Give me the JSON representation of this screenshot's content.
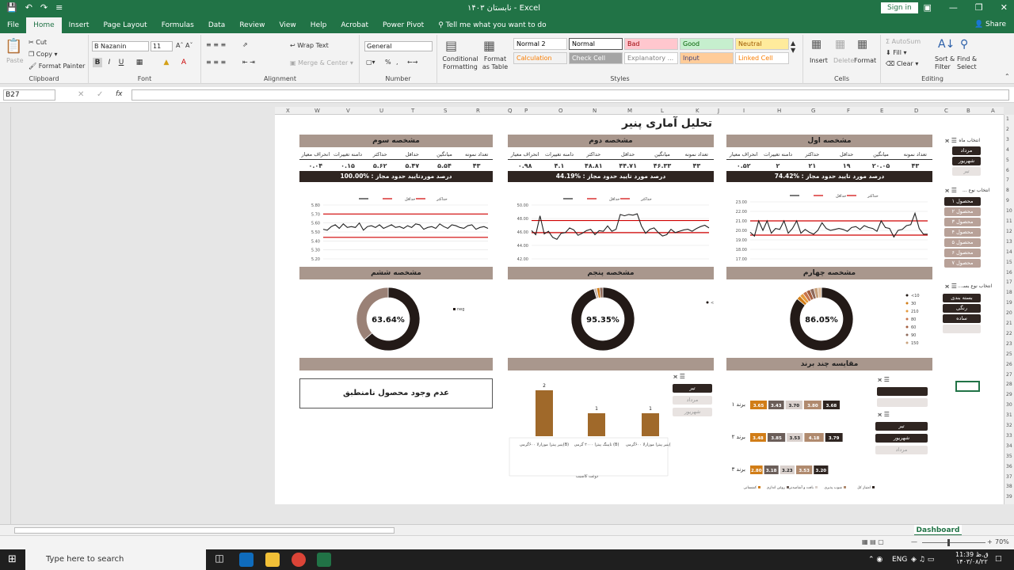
{
  "app": {
    "title": "نابستان ۱۴۰۳  -  Excel",
    "sign_in": "Sign in",
    "share": "Share"
  },
  "tabs": [
    "File",
    "Home",
    "Insert",
    "Page Layout",
    "Formulas",
    "Data",
    "Review",
    "View",
    "Help",
    "Acrobat",
    "Power Pivot",
    "Tell me what you want to do"
  ],
  "ribbon": {
    "clipboard": {
      "paste": "Paste",
      "cut": "Cut",
      "copy": "Copy",
      "format_painter": "Format Painter",
      "label": "Clipboard"
    },
    "font": {
      "name": "B Nazanin",
      "size": "11",
      "label": "Font",
      "bold": "B",
      "italic": "I",
      "underline": "U"
    },
    "alignment": {
      "wrap": "Wrap Text",
      "merge": "Merge & Center",
      "label": "Alignment"
    },
    "number": {
      "format": "General",
      "label": "Number",
      "pct": "%"
    },
    "styles": {
      "cond": "Conditional Formatting",
      "table": "Format as Table",
      "label": "Styles",
      "cells": [
        {
          "name": "Normal 2",
          "bg": "#ffffff",
          "fg": "#000000"
        },
        {
          "name": "Normal",
          "bg": "#ffffff",
          "fg": "#000000"
        },
        {
          "name": "Bad",
          "bg": "#ffc7ce",
          "fg": "#9c0006"
        },
        {
          "name": "Good",
          "bg": "#c6efce",
          "fg": "#006100"
        },
        {
          "name": "Neutral",
          "bg": "#ffeb9c",
          "fg": "#9c5700"
        },
        {
          "name": "Calculation",
          "bg": "#f2f2f2",
          "fg": "#fa7d00"
        },
        {
          "name": "Check Cell",
          "bg": "#a5a5a5",
          "fg": "#ffffff"
        },
        {
          "name": "Explanatory ...",
          "bg": "#ffffff",
          "fg": "#7f7f7f"
        },
        {
          "name": "Input",
          "bg": "#ffcc99",
          "fg": "#3f3f76"
        },
        {
          "name": "Linked Cell",
          "bg": "#ffffff",
          "fg": "#fa7d00"
        }
      ]
    },
    "cells": {
      "insert": "Insert",
      "delete": "Delete",
      "format": "Format",
      "label": "Cells"
    },
    "editing": {
      "autosum": "AutoSum",
      "fill": "Fill",
      "clear": "Clear",
      "sort": "Sort & Filter",
      "find": "Find & Select",
      "label": "Editing"
    }
  },
  "formula_bar": {
    "name_box": "B27",
    "formula": ""
  },
  "columns": [
    "X",
    "W",
    "V",
    "U",
    "T",
    "S",
    "R",
    "Q",
    "P",
    "O",
    "N",
    "M",
    "L",
    "K",
    "J",
    "I",
    "H",
    "G",
    "F",
    "E",
    "D",
    "C",
    "B",
    "A"
  ],
  "rows": [
    "1",
    "2",
    "3",
    "4",
    "5",
    "6",
    "7",
    "8",
    "9",
    "10",
    "11",
    "12",
    "13",
    "14",
    "15",
    "16",
    "17",
    "18",
    "19",
    "20",
    "21",
    "22",
    "23",
    "25",
    "26",
    "27",
    "28",
    "29",
    "30",
    "31",
    "32",
    "33",
    "34",
    "35",
    "36",
    "37",
    "38",
    "39"
  ],
  "dashboard": {
    "title": "تحلیل آماری پنیر",
    "kpi_headers": [
      "تعداد نمونه",
      "میانگین",
      "حداقل",
      "حداکثر",
      "دامنه تغییرات",
      "انحراف معیار"
    ],
    "sections": [
      {
        "title": "مشخصه اول",
        "values": [
          "۴۳",
          "۲۰.۰۵",
          "۱۹",
          "۲۱",
          "۲",
          "۰.۵۲"
        ],
        "conf": "74.42% : درصد مورد تایید حدود مجاز"
      },
      {
        "title": "مشخصه دوم",
        "values": [
          "۴۳",
          "۴۶.۳۳",
          "۴۴.۷۱",
          "۴۸.۸۱",
          "۴.۱",
          "۰.۹۸"
        ],
        "conf": "44.19% : درصد مورد تایید حدود مجاز"
      },
      {
        "title": "مشخصه سوم",
        "values": [
          "۴۳",
          "۵.۵۴",
          "۵.۴۷",
          "۵.۶۲",
          "۰.۱۵",
          "۰.۰۴"
        ],
        "conf": "100.00% : درصد موردتایید حدود مجاز"
      }
    ],
    "donut_headers": [
      "مشخصه چهارم",
      "مشخصه پنجم",
      "مشخصه ششم"
    ],
    "donut_values": [
      "86.05%",
      "95.35%",
      "63.64%"
    ],
    "compare_title": "مقایسه چند برند",
    "no_product": "عدم وجود محصول نامنطبق",
    "slicers": {
      "month_title": "انتخاب ماه",
      "month": [
        {
          "label": "مرداد",
          "on": true
        },
        {
          "label": "شهریور",
          "on": true
        },
        {
          "label": "تیر",
          "on": false
        }
      ],
      "type_title": "انتخاب نوع ...",
      "type": [
        "محصول ۱",
        "محصول ۲",
        "محصول ۳",
        "محصول ۴",
        "محصول ۵",
        "محصول ۶",
        "محصول ۷"
      ],
      "pack_title": "انتخاب نوع بسـ...",
      "pack": [
        "بسته بندی",
        "رنگی",
        "ساده"
      ],
      "bar_months": [
        {
          "label": "تیر",
          "on": true
        },
        {
          "label": "مرداد",
          "on": false
        },
        {
          "label": "شهریور",
          "on": false
        }
      ],
      "brand_months": [
        {
          "label": "تیر",
          "on": true
        },
        {
          "label": "شهریور",
          "on": true
        },
        {
          "label": "مرداد",
          "on": false
        }
      ]
    },
    "legend_minmax": [
      "حداکثر",
      "حداقل"
    ],
    "legend_neg": "neg",
    "legend_10": "<10",
    "legend_4": [
      "<10",
      "30",
      "210",
      "80",
      "60",
      "90",
      "150"
    ],
    "bar_caption": "دوغت کاسیب",
    "brand_legend": [
      "امتیاز کل",
      "شوب پذیری",
      "بافت و آشامیدنی",
      "روغن اندازی",
      "کشسانی"
    ]
  },
  "chart_data": [
    {
      "type": "line",
      "name": "مشخصه اول",
      "ylim": [
        17,
        23
      ],
      "yticks": [
        "23.00",
        "22.00",
        "21.00",
        "20.00",
        "19.00",
        "18.00",
        "17.00"
      ],
      "limits": [
        21,
        19.5
      ],
      "values": [
        19.8,
        19.4,
        21,
        20,
        21,
        19.7,
        20.2,
        20.1,
        21,
        19.7,
        20.2,
        21,
        19.7,
        20.1,
        19.8,
        19.6,
        20,
        20.8,
        20.2,
        20,
        20.1,
        20.2,
        20.1,
        19.9,
        20.3,
        20.4,
        20.1,
        20.5,
        20.3,
        20.2,
        19.9,
        21,
        20.3,
        20.2,
        19.3,
        20,
        20.1,
        20.5,
        20.6,
        21.8,
        20.2,
        19.6,
        19.6
      ]
    },
    {
      "type": "line",
      "name": "مشخصه دوم",
      "ylim": [
        42,
        50
      ],
      "yticks": [
        "50.00",
        "48.00",
        "46.00",
        "44.00",
        "42.00"
      ],
      "limits": [
        47.7,
        45.9
      ],
      "values": [
        46.2,
        45.6,
        48.4,
        45.7,
        46.1,
        45.2,
        44.9,
        45.8,
        45.9,
        46.6,
        46.3,
        45.5,
        45.8,
        46.2,
        46.4,
        45.6,
        46.2,
        46.1,
        46.9,
        46.1,
        46.4,
        48.6,
        48.4,
        48.6,
        48.5,
        48.7,
        46.9,
        45.8,
        46.4,
        46.6,
        45.9,
        45.4,
        45.6,
        46.4,
        45.9,
        46.1,
        46.3,
        46.4,
        46.1,
        46.5,
        46.8,
        47,
        46.6
      ]
    },
    {
      "type": "line",
      "name": "مشخصه سوم",
      "ylim": [
        5.2,
        5.8
      ],
      "yticks": [
        "5.80",
        "5.70",
        "5.60",
        "5.50",
        "5.40",
        "5.30",
        "5.20"
      ],
      "limits": [
        5.7,
        5.44
      ],
      "values": [
        5.53,
        5.52,
        5.56,
        5.58,
        5.54,
        5.59,
        5.55,
        5.56,
        5.55,
        5.6,
        5.52,
        5.56,
        5.57,
        5.55,
        5.58,
        5.54,
        5.56,
        5.58,
        5.55,
        5.56,
        5.54,
        5.57,
        5.55,
        5.59,
        5.58,
        5.53,
        5.55,
        5.56,
        5.54,
        5.59,
        5.56,
        5.54,
        5.58,
        5.57,
        5.55,
        5.54,
        5.57,
        5.58,
        5.53,
        5.55,
        5.56,
        5.54
      ]
    },
    {
      "type": "pie",
      "name": "مشخصه چهارم",
      "values": [
        86.05,
        2,
        2,
        2,
        2,
        2,
        2,
        1.95
      ],
      "label": "86.05%"
    },
    {
      "type": "pie",
      "name": "مشخصه پنجم",
      "values": [
        95.35,
        1.5,
        1.5,
        1.65
      ],
      "label": "95.35%"
    },
    {
      "type": "pie",
      "name": "مشخصه ششم",
      "values": [
        63.64,
        36.36
      ],
      "label": "63.64%"
    },
    {
      "type": "bar",
      "categories": [
        "پنیر پیتزا موزارلا ۶۰۰گرمی(B)",
        "تاپینگ پیتزا ۲۰۰۰ گرمی (B)",
        "پنیر پیتزا موزارلا ۶۰۰گرمی(B)"
      ],
      "values": [
        1,
        1,
        2
      ]
    },
    {
      "type": "bar",
      "orientation": "horizontal",
      "stacked": true,
      "categories": [
        "برند ۱",
        "برند ۲",
        "برند ۳"
      ],
      "series": [
        {
          "name": "کشسانی",
          "values": [
            3.65,
            3.48,
            2.8
          ]
        },
        {
          "name": "روغن اندازی",
          "values": [
            3.43,
            3.85,
            3.18
          ]
        },
        {
          "name": "بافت و آشامیدنی",
          "values": [
            3.7,
            3.53,
            3.23
          ]
        },
        {
          "name": "شوب پذیری",
          "values": [
            3.8,
            4.18,
            3.53
          ]
        },
        {
          "name": "امتیاز کل",
          "values": [
            3.68,
            3.79,
            3.2
          ]
        }
      ]
    }
  ],
  "colors": {
    "accent": "#217346",
    "header": "#a9978d",
    "dark": "#2f2521",
    "limit": "#d00000",
    "bar": "#a0692a",
    "s1": "#d17d17",
    "s2": "#6b5e59",
    "s3": "#d9d0cc",
    "s4": "#b08a6e",
    "s5": "#2f2521"
  },
  "sheet_tab": "Dashboard",
  "status": {
    "zoom": "70%"
  },
  "taskbar": {
    "search": "Type here to search",
    "lang": "ENG",
    "time": "11:39 ق.ظ",
    "date": "۱۴۰۳/۰۸/۲۲"
  }
}
